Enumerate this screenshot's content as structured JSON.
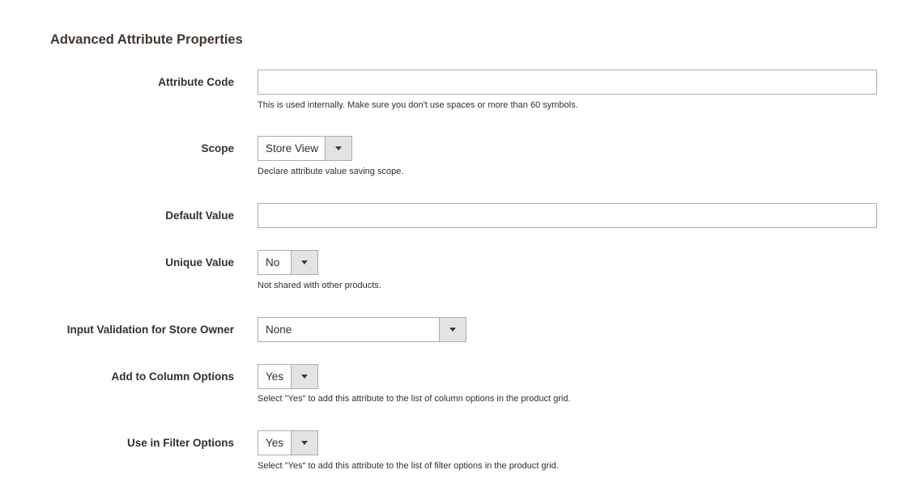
{
  "section": {
    "title": "Advanced Attribute Properties"
  },
  "fields": {
    "attribute_code": {
      "label": "Attribute Code",
      "value": "",
      "note": "This is used internally. Make sure you don't use spaces or more than 60 symbols."
    },
    "scope": {
      "label": "Scope",
      "selected": "Store View",
      "note": "Declare attribute value saving scope."
    },
    "default_value": {
      "label": "Default Value",
      "value": ""
    },
    "unique_value": {
      "label": "Unique Value",
      "selected": "No",
      "note": "Not shared with other products."
    },
    "input_validation": {
      "label": "Input Validation for Store Owner",
      "selected": "None"
    },
    "add_to_column_options": {
      "label": "Add to Column Options",
      "selected": "Yes",
      "note": "Select \"Yes\" to add this attribute to the list of column options in the product grid."
    },
    "use_in_filter_options": {
      "label": "Use in Filter Options",
      "selected": "Yes",
      "note": "Select \"Yes\" to add this attribute to the list of filter options in the product grid."
    }
  },
  "icons": {
    "dropdown": "chevron-down-icon"
  }
}
